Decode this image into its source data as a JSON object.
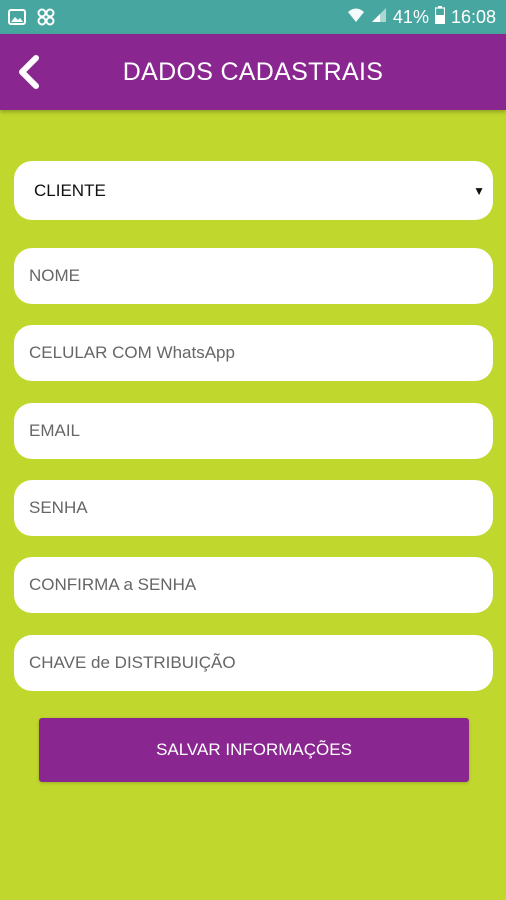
{
  "status_bar": {
    "battery_percent": "41%",
    "time": "16:08",
    "icons": [
      "gallery-icon",
      "app-notification-icon",
      "wifi-icon",
      "signal-icon",
      "battery-icon"
    ]
  },
  "header": {
    "title": "DADOS CADASTRAIS",
    "back_icon": "chevron-left-icon"
  },
  "form": {
    "account_type": {
      "selected": "CLIENTE"
    },
    "name_placeholder": "NOME",
    "phone_placeholder": "CELULAR COM WhatsApp",
    "email_placeholder": "EMAIL",
    "password_placeholder": "SENHA",
    "confirm_password_placeholder": "CONFIRMA a SENHA",
    "distribution_key_placeholder": "CHAVE de DISTRIBUIÇÃO",
    "save_label": "SALVAR INFORMAÇÕES"
  },
  "colors": {
    "background": "#c0d72e",
    "primary": "#8a2690",
    "status_bar": "#48a6a0"
  }
}
